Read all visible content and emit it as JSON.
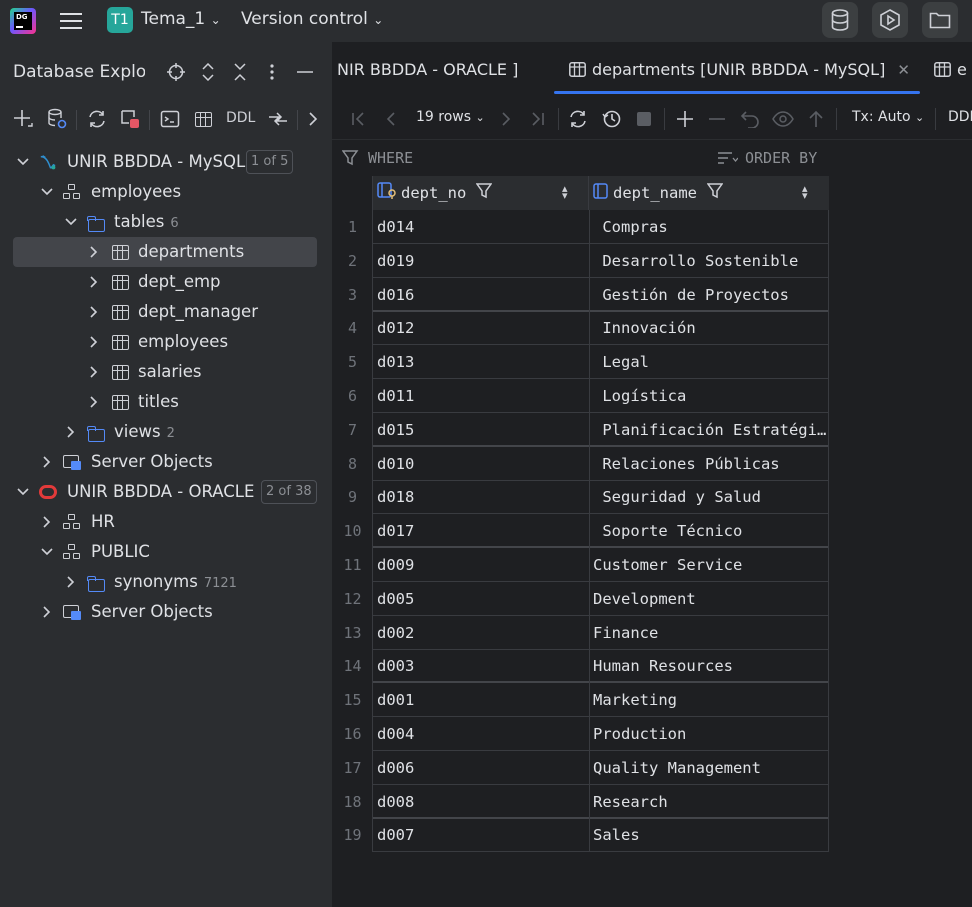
{
  "titlebar": {
    "project_badge": "T1",
    "project_name": "Tema_1",
    "version_control": "Version control",
    "app_logo_text": "DG"
  },
  "left_panel": {
    "title": "Database Explo",
    "ddl": "DDL"
  },
  "tree": [
    {
      "label": "UNIR BBDDA - MySQL",
      "badge": "1 of 5"
    },
    {
      "label": "employees"
    },
    {
      "label": "tables",
      "count": "6"
    },
    {
      "label": "departments"
    },
    {
      "label": "dept_emp"
    },
    {
      "label": "dept_manager"
    },
    {
      "label": "employees"
    },
    {
      "label": "salaries"
    },
    {
      "label": "titles"
    },
    {
      "label": "views",
      "count": "2"
    },
    {
      "label": "Server Objects"
    },
    {
      "label": "UNIR BBDDA - ORACLE",
      "badge": "2 of 38"
    },
    {
      "label": "HR"
    },
    {
      "label": "PUBLIC"
    },
    {
      "label": "synonyms",
      "count": "7121"
    },
    {
      "label": "Server Objects"
    }
  ],
  "tabs": {
    "tab1": "NIR BBDDA - ORACLE ]",
    "tab2": "departments [UNIR BBDDA - MySQL]",
    "tab3": "e"
  },
  "editor_toolbar": {
    "rows": "19 rows",
    "tx": "Tx: Auto",
    "ddl": "DDL"
  },
  "filter": {
    "where": "WHERE",
    "order_by": "ORDER BY"
  },
  "grid": {
    "columns": [
      "dept_no",
      "dept_name"
    ],
    "rows": [
      [
        "1",
        "d014",
        " Compras"
      ],
      [
        "2",
        "d019",
        " Desarrollo Sostenible"
      ],
      [
        "3",
        "d016",
        " Gestión de Proyectos"
      ],
      [
        "4",
        "d012",
        " Innovación"
      ],
      [
        "5",
        "d013",
        " Legal"
      ],
      [
        "6",
        "d011",
        " Logística"
      ],
      [
        "7",
        "d015",
        " Planificación Estratégica"
      ],
      [
        "8",
        "d010",
        " Relaciones Públicas"
      ],
      [
        "9",
        "d018",
        " Seguridad y Salud"
      ],
      [
        "10",
        "d017",
        " Soporte Técnico"
      ],
      [
        "11",
        "d009",
        "Customer Service"
      ],
      [
        "12",
        "d005",
        "Development"
      ],
      [
        "13",
        "d002",
        "Finance"
      ],
      [
        "14",
        "d003",
        "Human Resources"
      ],
      [
        "15",
        "d001",
        "Marketing"
      ],
      [
        "16",
        "d004",
        "Production"
      ],
      [
        "17",
        "d006",
        "Quality Management"
      ],
      [
        "18",
        "d008",
        "Research"
      ],
      [
        "19",
        "d007",
        "Sales"
      ]
    ]
  },
  "colors": {
    "accent": "#3574f0",
    "folder": "#548af7",
    "oracle": "#e23a3a",
    "badge": "#26a69a"
  }
}
